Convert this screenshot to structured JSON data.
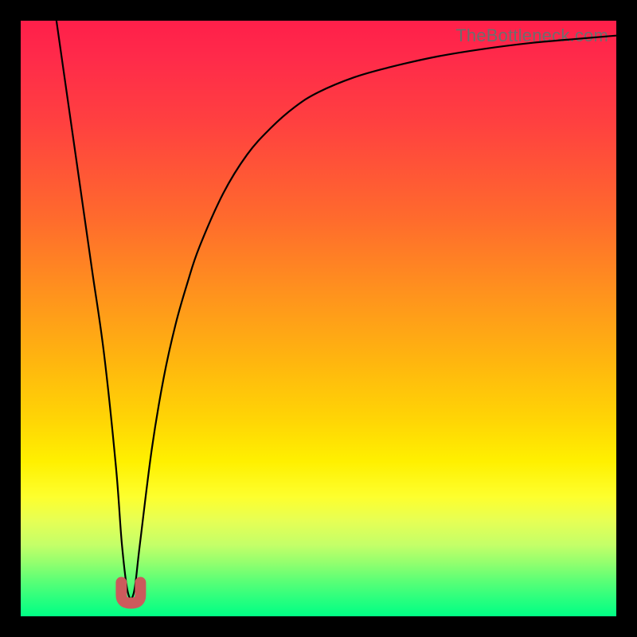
{
  "watermark": "TheBottleneck.com",
  "chart_data": {
    "type": "line",
    "title": "",
    "xlabel": "",
    "ylabel": "",
    "xlim": [
      0,
      100
    ],
    "ylim": [
      0,
      100
    ],
    "grid": false,
    "series": [
      {
        "name": "bottleneck-curve",
        "x": [
          6,
          8,
          10,
          12,
          14,
          16,
          17,
          18,
          19,
          20,
          22,
          24,
          26,
          28,
          30,
          34,
          38,
          42,
          46,
          50,
          56,
          62,
          70,
          78,
          86,
          94,
          100
        ],
        "values": [
          100,
          86,
          72,
          58,
          44,
          25,
          12,
          4,
          4,
          12,
          28,
          40,
          49,
          56,
          62,
          71,
          77.5,
          82,
          85.5,
          88,
          90.5,
          92.2,
          94,
          95.3,
          96.3,
          97,
          97.5
        ]
      }
    ],
    "annotations": [
      {
        "name": "minimum-marker",
        "shape": "u",
        "color": "#cb5a5c",
        "x": 18.5,
        "y": 3
      }
    ],
    "background_gradient": {
      "direction": "top-to-bottom",
      "stops": [
        {
          "pos": 0,
          "color": "#ff1f4a"
        },
        {
          "pos": 17,
          "color": "#ff4040"
        },
        {
          "pos": 46,
          "color": "#ff931d"
        },
        {
          "pos": 74,
          "color": "#fff000"
        },
        {
          "pos": 88,
          "color": "#c4ff68"
        },
        {
          "pos": 100,
          "color": "#00ff85"
        }
      ]
    }
  }
}
